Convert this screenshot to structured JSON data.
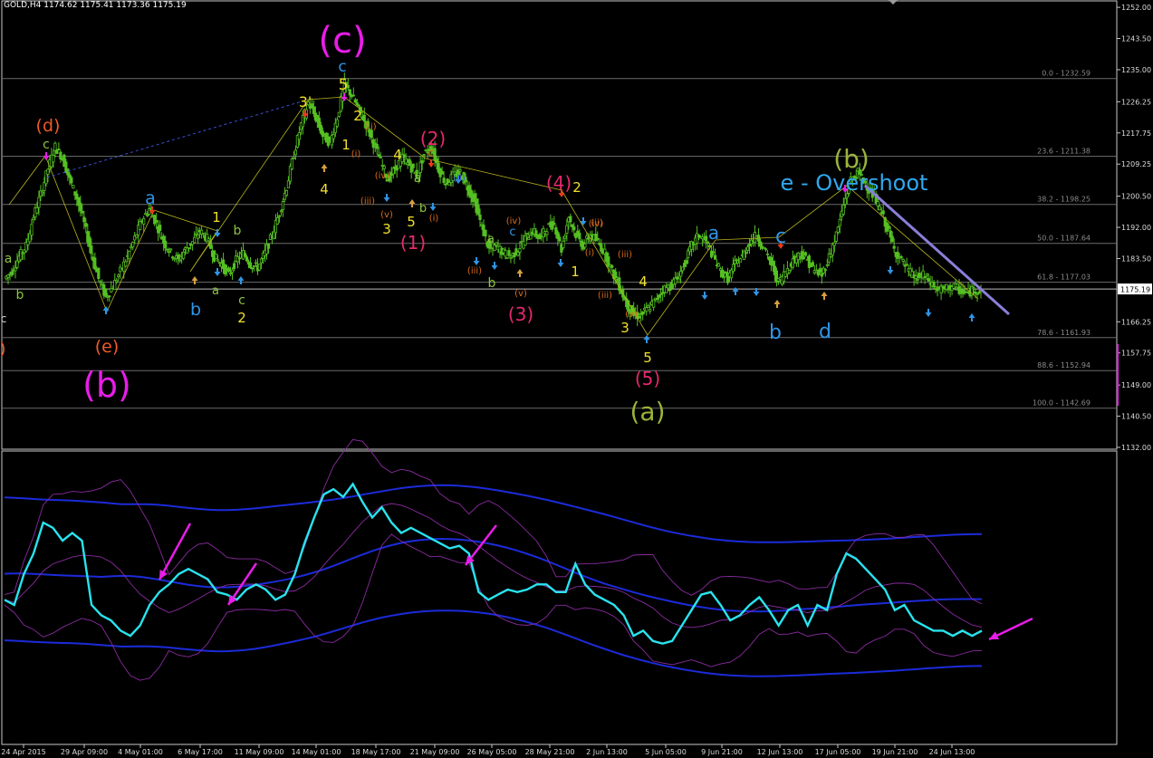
{
  "header": {
    "symbol": "GOLD,H4",
    "ohlc": "1174.62 1175.41 1173.36 1175.19"
  },
  "colors": {
    "candle": "#55c022",
    "fib_line": "#6b6b6b",
    "fib_label": "#8a8a8a",
    "price_box_bg": "#ffffff",
    "oscillator": "#29e3ee",
    "band_outer": "#1c2bd9",
    "band_inner": "#8a2ba0",
    "arrow_annotation": "#e81de8",
    "trendline": "#8a7fd8",
    "zigzag": "#b8b41e"
  },
  "chart_data": [
    {
      "type": "candlestick",
      "title": "GOLD,H4",
      "ylim": [
        1131.5,
        1254
      ],
      "price_axis_ticks": [
        "1252.00",
        "1243.50",
        "1235.00",
        "1226.25",
        "1217.75",
        "1209.25",
        "1200.50",
        "1192.00",
        "1183.50",
        "1175.19",
        "1166.25",
        "1157.75",
        "1149.00",
        "1140.50",
        "1132.00"
      ],
      "current_price": "1175.19",
      "time_ticks": [
        "24 Apr 2015",
        "29 Apr 09:00",
        "4 May 01:00",
        "6 May 17:00",
        "11 May 09:00",
        "14 May 01:00",
        "18 May 17:00",
        "21 May 09:00",
        "26 May 05:00",
        "28 May 21:00",
        "2 Jun 13:00",
        "5 Jun 05:00",
        "9 Jun 21:00",
        "12 Jun 13:00",
        "17 Jun 05:00",
        "19 Jun 21:00",
        "24 Jun 13:00"
      ],
      "fibonacci_levels": [
        {
          "label": "0.0 - 1232.59",
          "value": 1232.59
        },
        {
          "label": "23.6 - 1211.38",
          "value": 1211.38
        },
        {
          "label": "38.2 - 1198.25",
          "value": 1198.25
        },
        {
          "label": "50.0 - 1187.64",
          "value": 1187.64
        },
        {
          "label": "61.8 - 1177.03",
          "value": 1177.03
        },
        {
          "label": "78.6 - 1161.93",
          "value": 1161.93
        },
        {
          "label": "88.6 - 1152.94",
          "value": 1152.94
        },
        {
          "label": "100.0 - 1142.69",
          "value": 1142.69
        }
      ],
      "series": [
        {
          "name": "GOLD,H4",
          "price_path": [
            1178,
            1180,
            1184,
            1187,
            1195,
            1201,
            1208,
            1214,
            1211,
            1205,
            1200,
            1193,
            1185,
            1178,
            1173,
            1176,
            1180,
            1184,
            1189,
            1194,
            1197,
            1193,
            1188,
            1185,
            1183,
            1186,
            1188,
            1191,
            1189,
            1184,
            1182,
            1179,
            1183,
            1185,
            1182,
            1181,
            1185,
            1190,
            1196,
            1203,
            1212,
            1220,
            1226,
            1222,
            1217,
            1215,
            1222,
            1231,
            1228,
            1224,
            1220,
            1215,
            1210,
            1205,
            1208,
            1211,
            1209,
            1206,
            1212,
            1214,
            1208,
            1204,
            1206,
            1207,
            1203,
            1199,
            1192,
            1186,
            1187,
            1185,
            1184,
            1186,
            1189,
            1191,
            1189,
            1192,
            1193,
            1186,
            1195,
            1190,
            1187,
            1190,
            1188,
            1185,
            1180,
            1176,
            1171,
            1168,
            1168,
            1170,
            1172,
            1175,
            1176,
            1178,
            1182,
            1187,
            1190,
            1188,
            1184,
            1180,
            1178,
            1182,
            1184,
            1188,
            1190,
            1186,
            1182,
            1177,
            1180,
            1183,
            1185,
            1183,
            1180,
            1179,
            1184,
            1190,
            1198,
            1205,
            1207,
            1204,
            1201,
            1197,
            1192,
            1186,
            1183,
            1180,
            1178,
            1179,
            1177,
            1175,
            1175,
            1176,
            1175,
            1174,
            1175,
            1175
          ]
        }
      ]
    },
    {
      "type": "line",
      "title": "",
      "series": [
        {
          "name": "",
          "values": [
            0.52,
            0.5,
            0.62,
            0.7,
            0.82,
            0.8,
            0.75,
            0.78,
            0.75,
            0.5,
            0.46,
            0.44,
            0.4,
            0.38,
            0.42,
            0.5,
            0.55,
            0.58,
            0.62,
            0.64,
            0.62,
            0.6,
            0.55,
            0.54,
            0.52,
            0.56,
            0.58,
            0.56,
            0.52,
            0.54,
            0.62,
            0.74,
            0.84,
            0.93,
            0.95,
            0.92,
            0.97,
            0.9,
            0.84,
            0.88,
            0.82,
            0.78,
            0.8,
            0.78,
            0.76,
            0.74,
            0.72,
            0.73,
            0.7,
            0.55,
            0.52,
            0.54,
            0.56,
            0.55,
            0.56,
            0.58,
            0.58,
            0.55,
            0.55,
            0.66,
            0.58,
            0.54,
            0.52,
            0.5,
            0.46,
            0.38,
            0.4,
            0.36,
            0.35,
            0.36,
            0.42,
            0.48,
            0.54,
            0.55,
            0.5,
            0.44,
            0.46,
            0.5,
            0.53,
            0.48,
            0.42,
            0.48,
            0.5,
            0.42,
            0.5,
            0.48,
            0.62,
            0.7,
            0.68,
            0.64,
            0.6,
            0.56,
            0.48,
            0.5,
            0.44,
            0.42,
            0.4,
            0.4,
            0.38,
            0.4,
            0.38,
            0.4
          ]
        }
      ]
    }
  ],
  "wave_labels": [
    {
      "text": "(c)",
      "color": "#e81de8"
    },
    {
      "text": "c",
      "color": "#2f95e6"
    },
    {
      "text": "5",
      "color": "#f1e02a"
    },
    {
      "text": "3'",
      "color": "#f1e02a"
    },
    {
      "text": "(d)",
      "color": "#f05a28"
    },
    {
      "text": "c",
      "color": "#8ac43f"
    },
    {
      "text": "a",
      "color": "#8ac43f"
    },
    {
      "text": "b",
      "color": "#8ac43f"
    },
    {
      "text": "c",
      "color": "#d2d2d2"
    },
    {
      "text": "c)",
      "color": "#f05a28"
    },
    {
      "text": "(e)",
      "color": "#f05a28"
    },
    {
      "text": "(b)",
      "color": "#e81de8"
    },
    {
      "text": "a",
      "color": "#2f95e6"
    },
    {
      "text": "b",
      "color": "#2f95e6"
    },
    {
      "text": "1",
      "color": "#f1e02a"
    },
    {
      "text": "b",
      "color": "#8ac43f"
    },
    {
      "text": "a",
      "color": "#8ac43f"
    },
    {
      "text": "c",
      "color": "#8ac43f"
    },
    {
      "text": "2",
      "color": "#f1e02a"
    },
    {
      "text": "4",
      "color": "#f1e02a"
    },
    {
      "text": "2",
      "color": "#f1e02a"
    },
    {
      "text": "1",
      "color": "#f1e02a"
    },
    {
      "text": "(ii)",
      "color": "#d96b1c"
    },
    {
      "text": "(i)",
      "color": "#d96b1c"
    },
    {
      "text": "(iv)",
      "color": "#d96b1c"
    },
    {
      "text": "(iii)",
      "color": "#d96b1c"
    },
    {
      "text": "(v)",
      "color": "#d96b1c"
    },
    {
      "text": "3",
      "color": "#f1e02a"
    },
    {
      "text": "4",
      "color": "#f1e02a"
    },
    {
      "text": "a",
      "color": "#8ac43f"
    },
    {
      "text": "b",
      "color": "#8ac43f"
    },
    {
      "text": "5",
      "color": "#f1e02a"
    },
    {
      "text": "(i)",
      "color": "#d96b1c"
    },
    {
      "text": "(1)",
      "color": "#e6286e"
    },
    {
      "text": "(2)",
      "color": "#e6286e"
    },
    {
      "text": "c",
      "color": "#d96b1c"
    },
    {
      "text": "(ii)",
      "color": "#3d56e6"
    },
    {
      "text": "(iii)",
      "color": "#d96b1c"
    },
    {
      "text": "a",
      "color": "#8ac43f"
    },
    {
      "text": "b",
      "color": "#8ac43f"
    },
    {
      "text": "c",
      "color": "#2f95e6"
    },
    {
      "text": "(iv)",
      "color": "#d96b1c"
    },
    {
      "text": "(v)",
      "color": "#d96b1c"
    },
    {
      "text": "(3)",
      "color": "#e6286e"
    },
    {
      "text": "(4)",
      "color": "#e6286e"
    },
    {
      "text": "2",
      "color": "#f1e02a"
    },
    {
      "text": "(ii)",
      "color": "#d96b1c"
    },
    {
      "text": "(i)",
      "color": "#d96b1c"
    },
    {
      "text": "1",
      "color": "#f1e02a"
    },
    {
      "text": "(iii)",
      "color": "#d96b1c"
    },
    {
      "text": "(iii)",
      "color": "#d96b1c"
    },
    {
      "text": "(iv)",
      "color": "#d96b1c"
    },
    {
      "text": "4",
      "color": "#f1e02a"
    },
    {
      "text": "(v)",
      "color": "#d96b1c"
    },
    {
      "text": "3",
      "color": "#f1e02a"
    },
    {
      "text": "5",
      "color": "#f1e02a"
    },
    {
      "text": "(5)",
      "color": "#e6286e"
    },
    {
      "text": "(a)",
      "color": "#9ab43a"
    },
    {
      "text": "a",
      "color": "#2f95e6"
    },
    {
      "text": "b",
      "color": "#2f95e6"
    },
    {
      "text": "c",
      "color": "#2f95e6"
    },
    {
      "text": "d",
      "color": "#2f95e6"
    },
    {
      "text": "(b)",
      "color": "#9ab43a"
    },
    {
      "text": "e - Overshoot",
      "color": "#2fa8ee"
    }
  ]
}
